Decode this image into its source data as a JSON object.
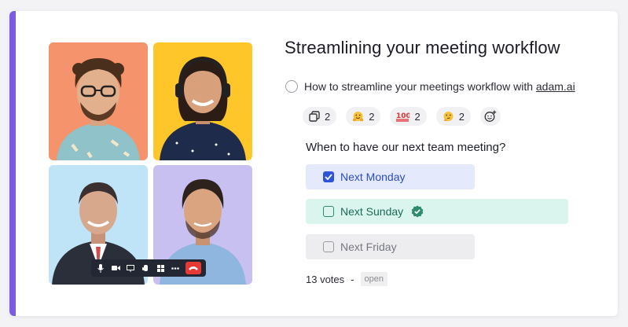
{
  "title": "Streamlining your meeting workflow",
  "task": {
    "text": "How to streamline your meetings workflow with ",
    "link": "adam.ai"
  },
  "reactions": [
    {
      "icon": "copy-icon",
      "count": "2"
    },
    {
      "icon": "hugging-face-emoji",
      "count": "2"
    },
    {
      "icon": "hundred-points-emoji",
      "count": "2"
    },
    {
      "icon": "thinking-face-emoji",
      "count": "2"
    }
  ],
  "add_reaction_icon": "add-emoji-icon",
  "poll": {
    "question": "When to have our next team meeting?",
    "options": [
      {
        "label": "Next Monday",
        "state": "checked"
      },
      {
        "label": "Next Sunday",
        "state": "winner"
      },
      {
        "label": "Next Friday",
        "state": "unchecked"
      }
    ],
    "votes": "13 votes",
    "separator": "-",
    "status": "open"
  },
  "colors": {
    "accent": "#7b5ce0",
    "selected_bg": "#e4e9fb",
    "winner_bg": "#d9f5ee",
    "end_call": "#e53935"
  },
  "call_controls": [
    "mic-icon",
    "camera-icon",
    "screen-share-icon",
    "raise-hand-icon",
    "grid-view-icon",
    "more-icon",
    "end-call-icon"
  ]
}
